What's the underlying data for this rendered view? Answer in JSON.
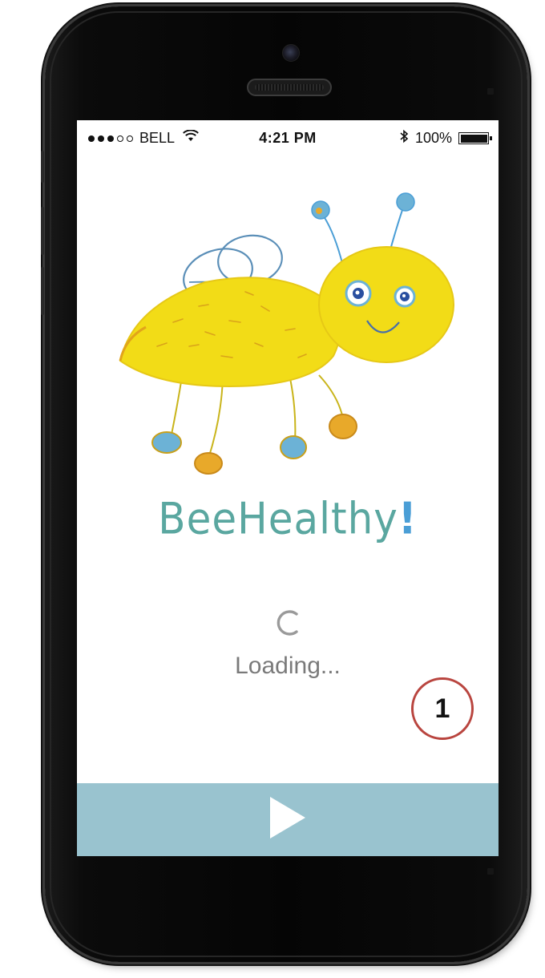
{
  "status_bar": {
    "carrier": "BELL",
    "time": "4:21 PM",
    "battery": "100%",
    "signal_bars_filled": 3,
    "signal_bars_total": 5
  },
  "app": {
    "name": "BeeHealthy",
    "name_suffix": "!",
    "loading_text": "Loading..."
  },
  "annotation": {
    "marker": "1"
  },
  "colors": {
    "title": "#5aa7a0",
    "accent": "#4a9ed6",
    "play_bar": "#99c3cf",
    "bee_body": "#f2dc17",
    "marker_ring": "#b9453f"
  },
  "icons": {
    "play": "play-icon",
    "spinner": "spinner-icon",
    "wifi": "wifi-icon",
    "bluetooth": "bluetooth-icon",
    "battery": "battery-icon",
    "bee": "bee-illustration"
  }
}
